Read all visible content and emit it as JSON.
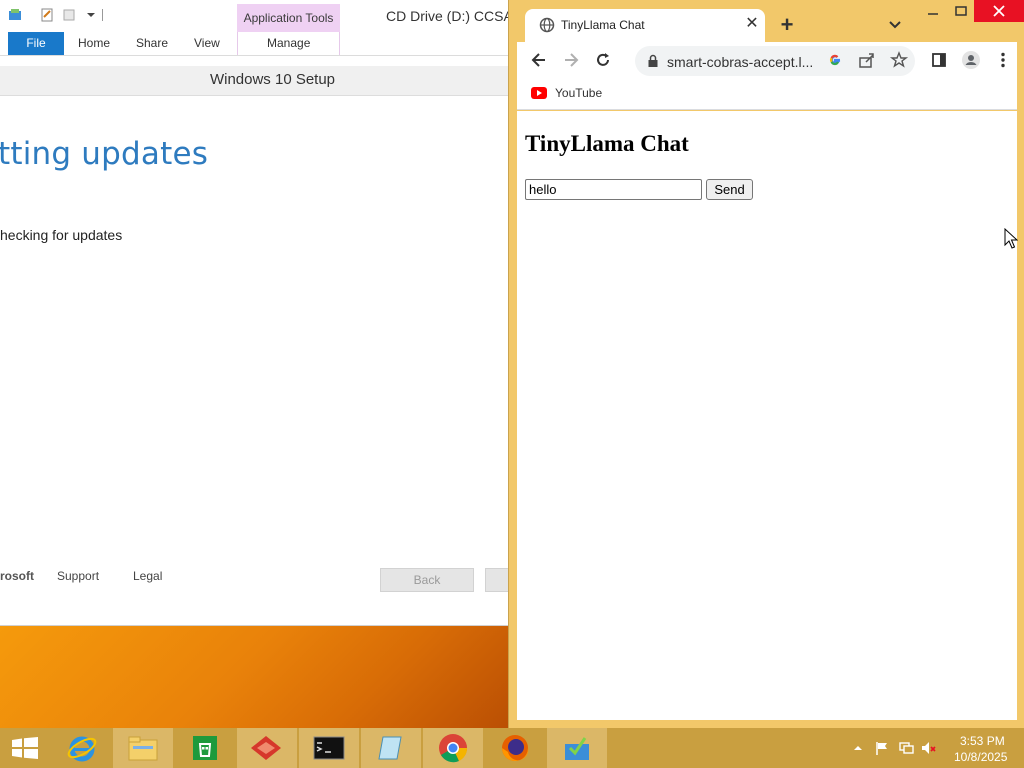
{
  "explorer": {
    "title": "CD Drive (D:) CCSA",
    "app_tools_label": "Application Tools",
    "ribbon_tabs": [
      "File",
      "Home",
      "Share",
      "View",
      "Manage"
    ]
  },
  "setup": {
    "title": "Windows 10 Setup",
    "heading": "tting updates",
    "status": "hecking for updates",
    "footer_brand": "rosoft",
    "support_label": "Support",
    "legal_label": "Legal",
    "back_label": "Back"
  },
  "chrome": {
    "tab_title": "TinyLlama Chat",
    "url": "smart-cobras-accept.l...",
    "bookmarks": [
      {
        "label": "YouTube"
      }
    ],
    "page": {
      "heading": "TinyLlama Chat",
      "input_value": "hello",
      "send_label": "Send"
    }
  },
  "taskbar": {
    "apps": [
      "start-icon",
      "internet-explorer-icon",
      "file-explorer-icon",
      "store-icon",
      "app-red-icon",
      "command-prompt-icon",
      "notepad-icon",
      "chrome-icon",
      "firefox-icon",
      "setup-icon"
    ],
    "time": "3:53 PM",
    "date": "10/8/2025"
  },
  "colors": {
    "chrome_frame": "#f2c86a",
    "taskbar": "#c99f40",
    "file_tab": "#1979ca",
    "app_tools": "#efd1f3",
    "setup_heading": "#2e7bbf",
    "close_red": "#e81123"
  }
}
